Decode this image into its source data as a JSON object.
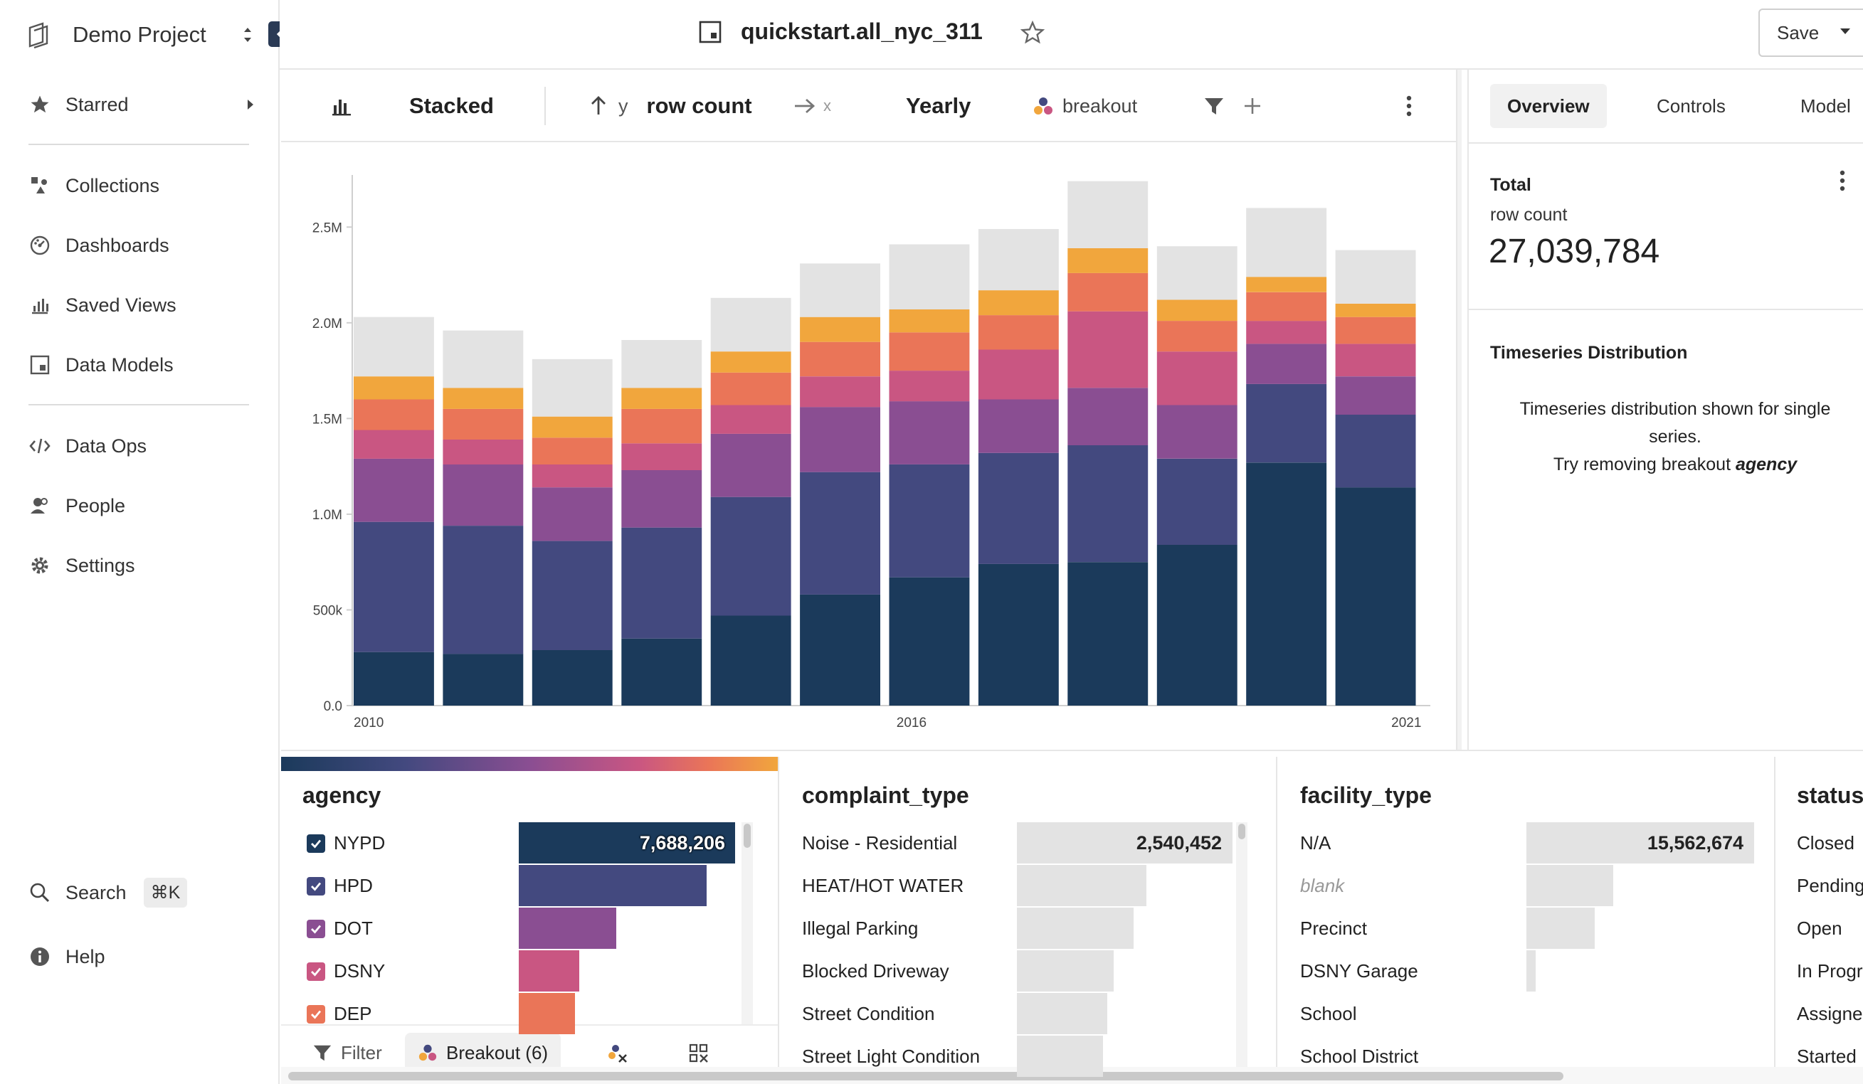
{
  "sidebar": {
    "project_name": "Demo Project",
    "starred": "Starred",
    "items": [
      {
        "label": "Collections",
        "icon": "collections-icon"
      },
      {
        "label": "Dashboards",
        "icon": "dashboards-icon"
      },
      {
        "label": "Saved Views",
        "icon": "saved-views-icon"
      },
      {
        "label": "Data Models",
        "icon": "data-models-icon"
      }
    ],
    "items2": [
      {
        "label": "Data Ops",
        "icon": "code-icon"
      },
      {
        "label": "People",
        "icon": "people-icon"
      },
      {
        "label": "Settings",
        "icon": "gear-icon"
      }
    ],
    "search_label": "Search",
    "search_shortcut": "⌘K",
    "help_label": "Help"
  },
  "topbar": {
    "title": "quickstart.all_nyc_311",
    "save_label": "Save"
  },
  "toolbar": {
    "chart_mode": "Stacked",
    "y_axis_letter": "y",
    "y_metric": "row count",
    "x_axis_letter": "x",
    "granularity": "Yearly",
    "breakout_label": "breakout"
  },
  "right_panel": {
    "tabs": [
      "Overview",
      "Controls",
      "Model"
    ],
    "active_tab": "Overview",
    "total_label": "Total",
    "metric_label": "row count",
    "total_value": "27,039,784",
    "ts_title": "Timeseries Distribution",
    "ts_msg_1": "Timeseries distribution shown for single",
    "ts_msg_2": "series.",
    "ts_msg_3_prefix": "Try removing breakout",
    "ts_msg_3_em": "agency"
  },
  "chart_data": {
    "type": "bar",
    "stacked": true,
    "x_tick_labels": [
      "2010",
      "2016",
      "2021"
    ],
    "y_tick_labels": [
      "0.0",
      "500k",
      "1.0M",
      "1.5M",
      "2.0M",
      "2.5M"
    ],
    "ylim": [
      0,
      2750000
    ],
    "categories": [
      "2010",
      "2011",
      "2012",
      "2013",
      "2014",
      "2015",
      "2016",
      "2017",
      "2018",
      "2019",
      "2020",
      "2021"
    ],
    "series": [
      {
        "color": "#1b3a5b",
        "values": [
          280000,
          270000,
          290000,
          350000,
          470000,
          580000,
          670000,
          740000,
          750000,
          840000,
          1270000,
          1140000
        ]
      },
      {
        "color": "#43497f",
        "values": [
          680000,
          670000,
          570000,
          580000,
          620000,
          640000,
          590000,
          580000,
          610000,
          450000,
          410000,
          380000
        ]
      },
      {
        "color": "#8a4e92",
        "values": [
          330000,
          320000,
          280000,
          300000,
          330000,
          340000,
          330000,
          280000,
          300000,
          280000,
          210000,
          200000
        ]
      },
      {
        "color": "#c95682",
        "values": [
          150000,
          130000,
          120000,
          140000,
          150000,
          160000,
          160000,
          260000,
          400000,
          280000,
          120000,
          170000
        ]
      },
      {
        "color": "#ea7558",
        "values": [
          160000,
          160000,
          140000,
          180000,
          170000,
          180000,
          200000,
          180000,
          200000,
          160000,
          150000,
          140000
        ]
      },
      {
        "color": "#f1a63d",
        "values": [
          120000,
          110000,
          110000,
          110000,
          110000,
          130000,
          120000,
          130000,
          130000,
          110000,
          80000,
          70000
        ]
      },
      {
        "color": "#e3e3e3",
        "values": [
          310000,
          300000,
          300000,
          250000,
          280000,
          280000,
          340000,
          320000,
          350000,
          280000,
          360000,
          280000
        ]
      }
    ]
  },
  "bottom": {
    "agency": {
      "title": "agency",
      "rows": [
        {
          "label": "NYPD",
          "value": "7,688,206",
          "frac": 1.0,
          "color": "#1b3a5b"
        },
        {
          "label": "HPD",
          "value": "",
          "frac": 0.87,
          "color": "#43497f"
        },
        {
          "label": "DOT",
          "value": "",
          "frac": 0.45,
          "color": "#8a4e92"
        },
        {
          "label": "DSNY",
          "value": "",
          "frac": 0.28,
          "color": "#c95682"
        },
        {
          "label": "DEP",
          "value": "",
          "frac": 0.26,
          "color": "#ea7558"
        }
      ]
    },
    "complaint_type": {
      "title": "complaint_type",
      "rows": [
        {
          "label": "Noise - Residential",
          "value": "2,540,452",
          "frac": 1.0
        },
        {
          "label": "HEAT/HOT WATER",
          "value": "",
          "frac": 0.6
        },
        {
          "label": "Illegal Parking",
          "value": "",
          "frac": 0.54
        },
        {
          "label": "Blocked Driveway",
          "value": "",
          "frac": 0.45
        },
        {
          "label": "Street Condition",
          "value": "",
          "frac": 0.42
        },
        {
          "label": "Street Light Condition",
          "value": "",
          "frac": 0.4
        }
      ]
    },
    "facility_type": {
      "title": "facility_type",
      "rows": [
        {
          "label": "N/A",
          "value": "15,562,674",
          "frac": 1.0,
          "italic": false
        },
        {
          "label": "blank",
          "value": "",
          "frac": 0.38,
          "italic": true
        },
        {
          "label": "Precinct",
          "value": "",
          "frac": 0.3,
          "italic": false
        },
        {
          "label": "DSNY Garage",
          "value": "",
          "frac": 0.04,
          "italic": false
        },
        {
          "label": "School",
          "value": "",
          "frac": 0,
          "italic": false
        },
        {
          "label": "School District",
          "value": "",
          "frac": 0,
          "italic": false
        }
      ]
    },
    "status": {
      "title": "status",
      "rows": [
        "Closed",
        "Pending",
        "Open",
        "In Progr",
        "Assigne",
        "Started"
      ]
    },
    "footer": {
      "filter_label": "Filter",
      "breakout_label": "Breakout (6)"
    }
  }
}
